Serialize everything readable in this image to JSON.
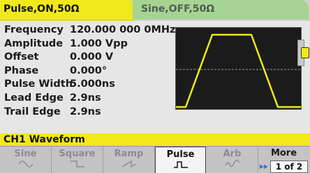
{
  "tabs": {
    "active": "Pulse,ON,50Ω",
    "inactive": "Sine,OFF,50Ω"
  },
  "params": [
    {
      "label": "Frequency",
      "value": "120.000 000 0MHz"
    },
    {
      "label": "Amplitude",
      "value": "1.000 Vpp"
    },
    {
      "label": "Offset",
      "value": "0.000 V"
    },
    {
      "label": "Phase",
      "value": "0.000°"
    },
    {
      "label": "Pulse Width",
      "value": "5.000ns"
    },
    {
      "label": "Lead Edge",
      "value": "2.9ns"
    },
    {
      "label": "Trail Edge",
      "value": "2.9ns"
    }
  ],
  "status": "CH1 Waveform",
  "softkeys": {
    "sine": {
      "label": "Sine",
      "icon": "sine-wave-icon"
    },
    "square": {
      "label": "Square",
      "icon": "square-wave-icon"
    },
    "ramp": {
      "label": "Ramp",
      "icon": "ramp-wave-icon"
    },
    "pulse": {
      "label": "Pulse",
      "icon": "pulse-wave-icon"
    },
    "arb": {
      "label": "Arb",
      "icon": "arb-wave-icon"
    },
    "more": {
      "label": "More",
      "page": "1 of 2"
    }
  },
  "colors": {
    "accent_yellow": "#f2e91a",
    "inactive_tab_green": "#a6d493",
    "more_arrow_blue": "#3a6bd8"
  }
}
